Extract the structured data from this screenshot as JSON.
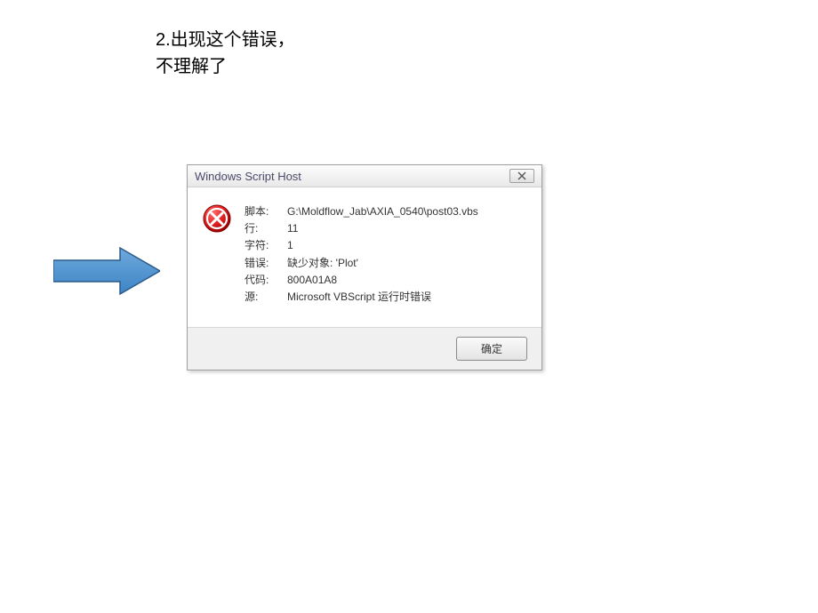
{
  "description": {
    "line1": "2.出现这个错误，",
    "line2": "不理解了"
  },
  "dialog": {
    "title": "Windows Script Host",
    "fields": {
      "script_label": "脚本:",
      "script_value": "G:\\Moldflow_Jab\\AXIA_0540\\post03.vbs",
      "line_label": "行:",
      "line_value": "11",
      "char_label": "字符:",
      "char_value": "1",
      "error_label": "错误:",
      "error_value": "缺少对象: 'Plot'",
      "code_label": "代码:",
      "code_value": "800A01A8",
      "source_label": "源:",
      "source_value": "Microsoft VBScript 运行时错误"
    },
    "ok_button": "确定"
  }
}
